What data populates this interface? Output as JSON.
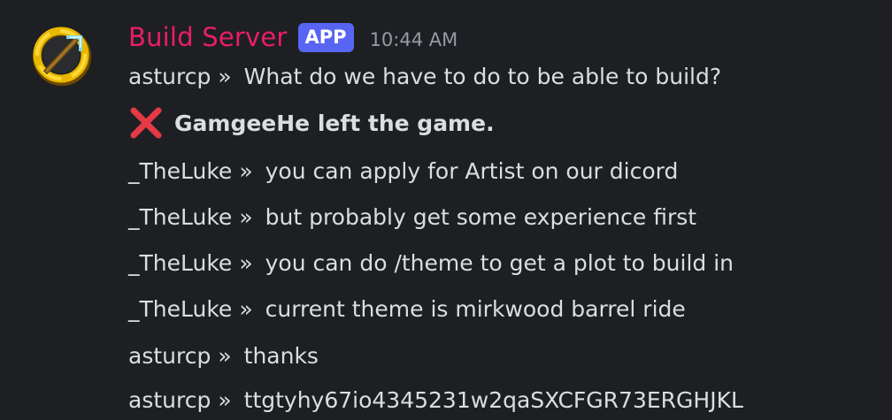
{
  "message": {
    "username": "Build Server",
    "badge": "APP",
    "timestamp": "10:44 AM",
    "avatar_icon": "golden-ring-pickaxe-icon",
    "colors": {
      "username": "#e91e63",
      "badge_bg": "#5865f2",
      "background": "#1e1f22",
      "text": "#dbdee1",
      "timestamp": "#949ba4"
    },
    "lines": [
      {
        "type": "chat",
        "author": "asturcp",
        "separator": "»",
        "text": "What do we have to do to be able to build?"
      },
      {
        "type": "event",
        "icon": "red-x-icon",
        "text": "GamgeeHe left the game."
      },
      {
        "type": "chat",
        "author": "_TheLuke",
        "separator": "»",
        "text": "you can apply for Artist on our dicord"
      },
      {
        "type": "chat",
        "author": "_TheLuke",
        "separator": "»",
        "text": "but probably get some experience first"
      },
      {
        "type": "chat",
        "author": "_TheLuke",
        "separator": "»",
        "text": "you can do /theme to get a plot to build in"
      },
      {
        "type": "chat",
        "author": "_TheLuke",
        "separator": "»",
        "text": "current theme is mirkwood barrel ride"
      },
      {
        "type": "chat",
        "author": "asturcp",
        "separator": "»",
        "text": "thanks"
      },
      {
        "type": "chat",
        "author": "asturcp",
        "separator": "»",
        "text": "ttgtyhy67io4345231w2qaSXCFGR73ERGHJKL"
      }
    ]
  }
}
